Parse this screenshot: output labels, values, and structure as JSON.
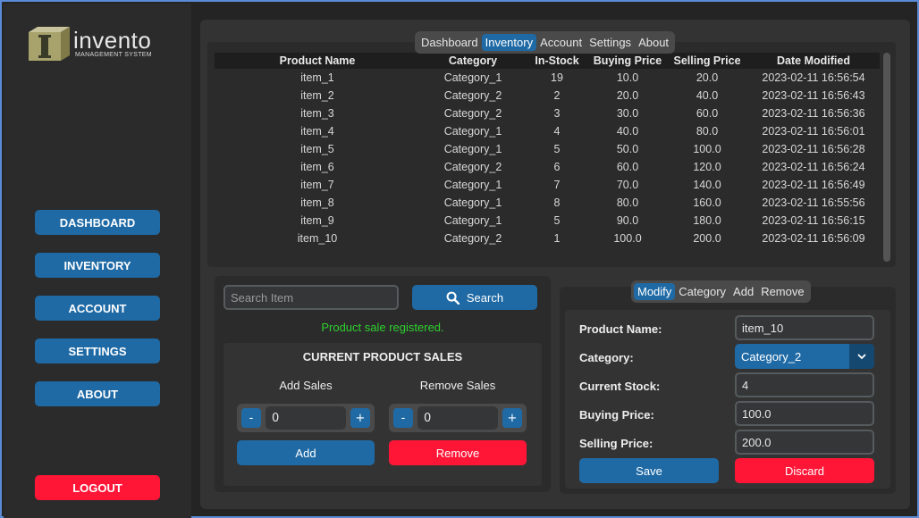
{
  "brand": {
    "name": "invento",
    "subtitle": "MANAGEMENT SYSTEM"
  },
  "sidebar": {
    "items": [
      {
        "label": "DASHBOARD"
      },
      {
        "label": "INVENTORY"
      },
      {
        "label": "ACCOUNT"
      },
      {
        "label": "SETTINGS"
      },
      {
        "label": "ABOUT"
      }
    ],
    "logout_label": "LOGOUT"
  },
  "tabs": [
    {
      "label": "Dashboard",
      "active": false
    },
    {
      "label": "Inventory",
      "active": true
    },
    {
      "label": "Account",
      "active": false
    },
    {
      "label": "Settings",
      "active": false
    },
    {
      "label": "About",
      "active": false
    }
  ],
  "table": {
    "columns": [
      "Product Name",
      "Category",
      "In-Stock",
      "Buying Price",
      "Selling Price",
      "Date Modified"
    ],
    "rows": [
      [
        "item_1",
        "Category_1",
        "19",
        "10.0",
        "20.0",
        "2023-02-11 16:56:54"
      ],
      [
        "item_2",
        "Category_2",
        "2",
        "20.0",
        "40.0",
        "2023-02-11 16:56:43"
      ],
      [
        "item_3",
        "Category_2",
        "3",
        "30.0",
        "60.0",
        "2023-02-11 16:56:36"
      ],
      [
        "item_4",
        "Category_1",
        "4",
        "40.0",
        "80.0",
        "2023-02-11 16:56:01"
      ],
      [
        "item_5",
        "Category_1",
        "5",
        "50.0",
        "100.0",
        "2023-02-11 16:56:28"
      ],
      [
        "item_6",
        "Category_2",
        "6",
        "60.0",
        "120.0",
        "2023-02-11 16:56:24"
      ],
      [
        "item_7",
        "Category_1",
        "7",
        "70.0",
        "140.0",
        "2023-02-11 16:56:49"
      ],
      [
        "item_8",
        "Category_1",
        "8",
        "80.0",
        "160.0",
        "2023-02-11 16:55:56"
      ],
      [
        "item_9",
        "Category_1",
        "5",
        "90.0",
        "180.0",
        "2023-02-11 16:56:15"
      ],
      [
        "item_10",
        "Category_2",
        "1",
        "100.0",
        "200.0",
        "2023-02-11 16:56:09"
      ]
    ]
  },
  "sales": {
    "search_placeholder": "Search Item",
    "search_label": "Search",
    "status": "Product sale registered.",
    "title": "CURRENT PRODUCT SALES",
    "add_label": "Add Sales",
    "remove_label": "Remove Sales",
    "add_value": "0",
    "remove_value": "0",
    "minus": "-",
    "plus": "+",
    "add_button": "Add",
    "remove_button": "Remove"
  },
  "modify": {
    "tabs": [
      {
        "label": "Modify",
        "active": true
      },
      {
        "label": "Category",
        "active": false
      },
      {
        "label": "Add",
        "active": false
      },
      {
        "label": "Remove",
        "active": false
      }
    ],
    "product_name_label": "Product Name:",
    "product_name": "item_10",
    "category_label": "Category:",
    "category": "Category_2",
    "stock_label": "Current Stock:",
    "stock": "4",
    "buying_label": "Buying Price:",
    "buying": "100.0",
    "selling_label": "Selling Price:",
    "selling": "200.0",
    "save_label": "Save",
    "discard_label": "Discard"
  },
  "colors": {
    "accent": "#1f6aa5",
    "danger": "#ff1637",
    "success": "#2ed12e"
  }
}
